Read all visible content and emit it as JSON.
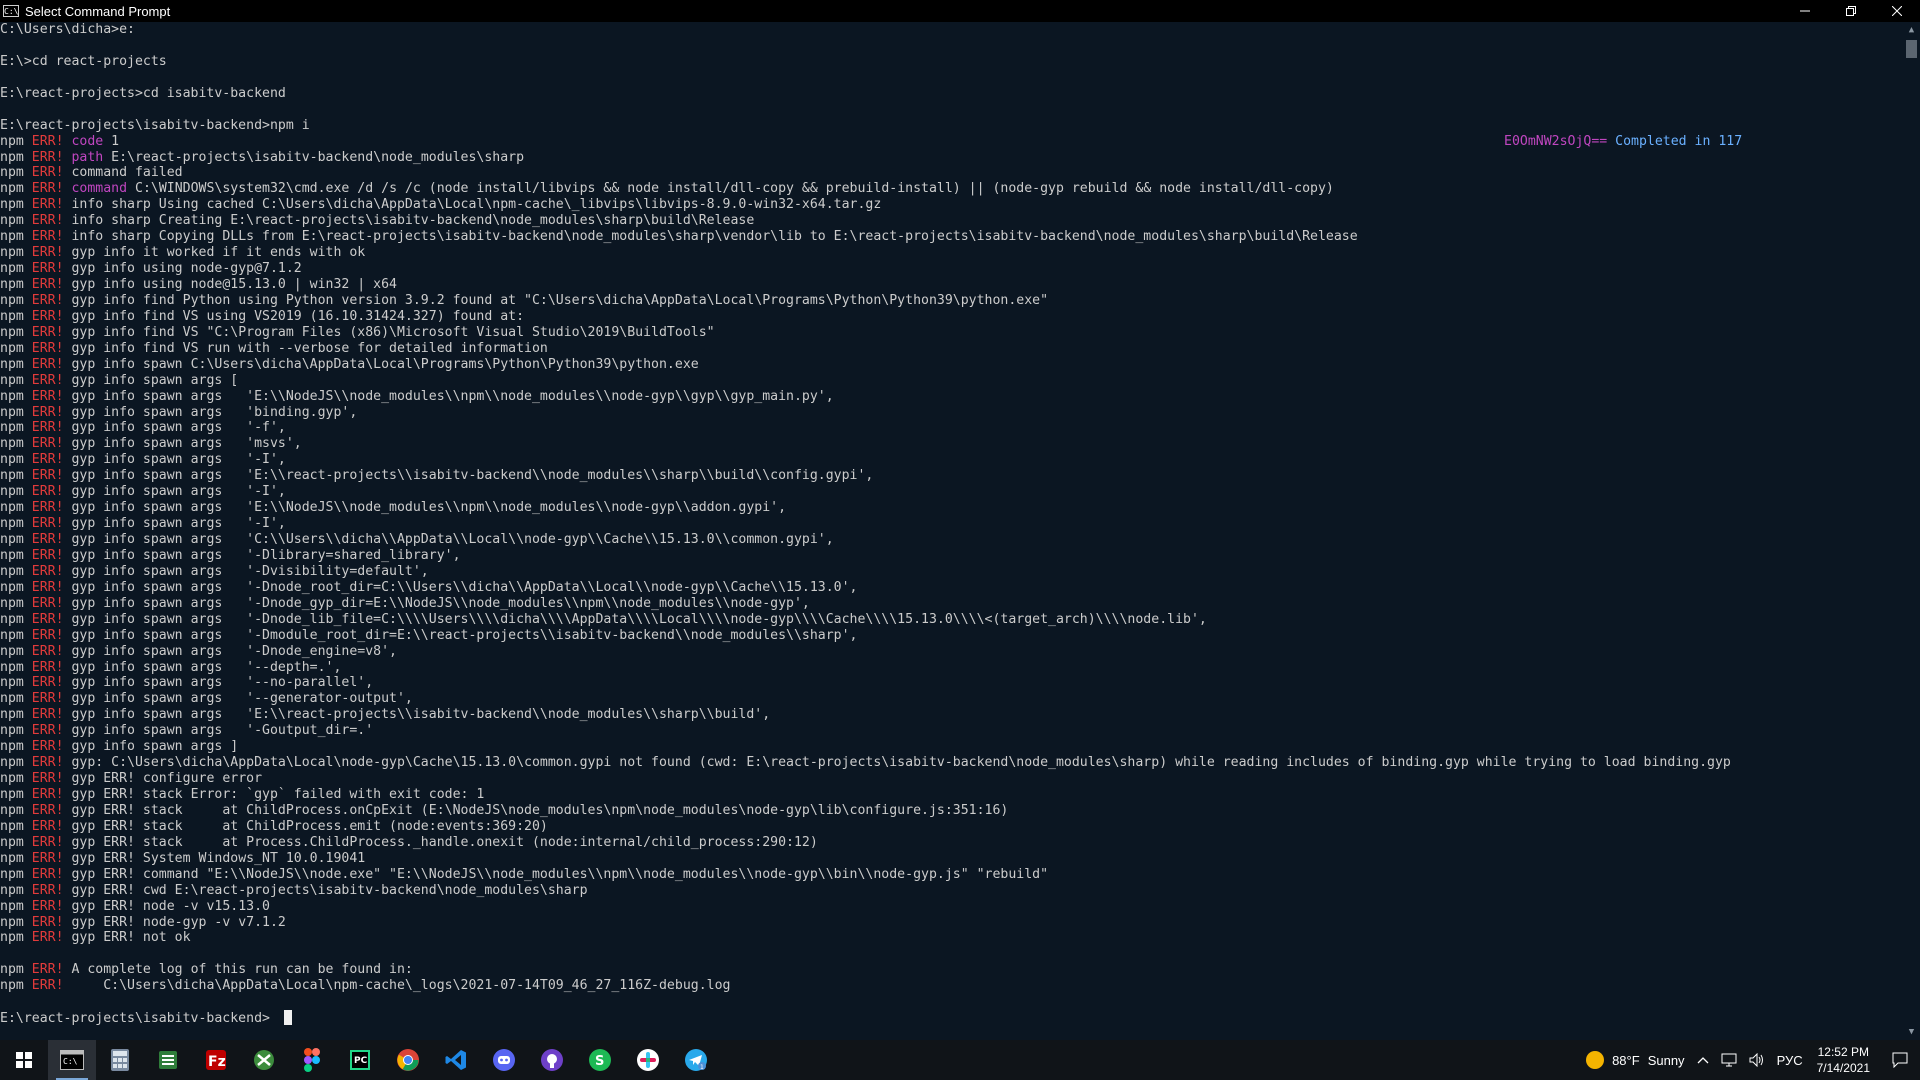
{
  "window": {
    "title": "Select Command Prompt",
    "icon_label": "C:\\"
  },
  "colors": {
    "background": "#0b1622",
    "text": "#cccccc",
    "err": "#e23b3b",
    "keyword": "#c046c0",
    "completed": "#6ab0ff"
  },
  "overlay": {
    "hash": "E0OmNW2sOjQ==",
    "completed": " Completed in 117"
  },
  "console_lines": [
    {
      "parts": [
        {
          "c": "txt",
          "t": "C:\\Users\\dicha>e:"
        }
      ]
    },
    {
      "parts": [
        {
          "c": "txt",
          "t": ""
        }
      ]
    },
    {
      "parts": [
        {
          "c": "txt",
          "t": "E:\\>cd react-projects"
        }
      ]
    },
    {
      "parts": [
        {
          "c": "txt",
          "t": ""
        }
      ]
    },
    {
      "parts": [
        {
          "c": "txt",
          "t": "E:\\react-projects>cd isabitv-backend"
        }
      ]
    },
    {
      "parts": [
        {
          "c": "txt",
          "t": ""
        }
      ]
    },
    {
      "parts": [
        {
          "c": "txt",
          "t": "E:\\react-projects\\isabitv-backend>npm i"
        }
      ]
    },
    {
      "parts": [
        {
          "c": "npm",
          "t": "npm "
        },
        {
          "c": "err",
          "t": "ERR!"
        },
        {
          "c": "kw",
          "t": " code"
        },
        {
          "c": "txt",
          "t": " 1"
        }
      ]
    },
    {
      "parts": [
        {
          "c": "npm",
          "t": "npm "
        },
        {
          "c": "err",
          "t": "ERR!"
        },
        {
          "c": "kw",
          "t": " path"
        },
        {
          "c": "txt",
          "t": " E:\\react-projects\\isabitv-backend\\node_modules\\sharp"
        }
      ]
    },
    {
      "parts": [
        {
          "c": "npm",
          "t": "npm "
        },
        {
          "c": "err",
          "t": "ERR!"
        },
        {
          "c": "txt",
          "t": " command failed"
        }
      ]
    },
    {
      "parts": [
        {
          "c": "npm",
          "t": "npm "
        },
        {
          "c": "err",
          "t": "ERR!"
        },
        {
          "c": "kw",
          "t": " command"
        },
        {
          "c": "txt",
          "t": " C:\\WINDOWS\\system32\\cmd.exe /d /s /c (node install/libvips && node install/dll-copy && prebuild-install) || (node-gyp rebuild && node install/dll-copy)"
        }
      ]
    },
    {
      "parts": [
        {
          "c": "npm",
          "t": "npm "
        },
        {
          "c": "err",
          "t": "ERR!"
        },
        {
          "c": "txt",
          "t": " info sharp Using cached C:\\Users\\dicha\\AppData\\Local\\npm-cache\\_libvips\\libvips-8.9.0-win32-x64.tar.gz"
        }
      ]
    },
    {
      "parts": [
        {
          "c": "npm",
          "t": "npm "
        },
        {
          "c": "err",
          "t": "ERR!"
        },
        {
          "c": "txt",
          "t": " info sharp Creating E:\\react-projects\\isabitv-backend\\node_modules\\sharp\\build\\Release"
        }
      ]
    },
    {
      "parts": [
        {
          "c": "npm",
          "t": "npm "
        },
        {
          "c": "err",
          "t": "ERR!"
        },
        {
          "c": "txt",
          "t": " info sharp Copying DLLs from E:\\react-projects\\isabitv-backend\\node_modules\\sharp\\vendor\\lib to E:\\react-projects\\isabitv-backend\\node_modules\\sharp\\build\\Release"
        }
      ]
    },
    {
      "parts": [
        {
          "c": "npm",
          "t": "npm "
        },
        {
          "c": "err",
          "t": "ERR!"
        },
        {
          "c": "txt",
          "t": " gyp info it worked if it ends with ok"
        }
      ]
    },
    {
      "parts": [
        {
          "c": "npm",
          "t": "npm "
        },
        {
          "c": "err",
          "t": "ERR!"
        },
        {
          "c": "txt",
          "t": " gyp info using node-gyp@7.1.2"
        }
      ]
    },
    {
      "parts": [
        {
          "c": "npm",
          "t": "npm "
        },
        {
          "c": "err",
          "t": "ERR!"
        },
        {
          "c": "txt",
          "t": " gyp info using node@15.13.0 | win32 | x64"
        }
      ]
    },
    {
      "parts": [
        {
          "c": "npm",
          "t": "npm "
        },
        {
          "c": "err",
          "t": "ERR!"
        },
        {
          "c": "txt",
          "t": " gyp info find Python using Python version 3.9.2 found at \"C:\\Users\\dicha\\AppData\\Local\\Programs\\Python\\Python39\\python.exe\""
        }
      ]
    },
    {
      "parts": [
        {
          "c": "npm",
          "t": "npm "
        },
        {
          "c": "err",
          "t": "ERR!"
        },
        {
          "c": "txt",
          "t": " gyp info find VS using VS2019 (16.10.31424.327) found at:"
        }
      ]
    },
    {
      "parts": [
        {
          "c": "npm",
          "t": "npm "
        },
        {
          "c": "err",
          "t": "ERR!"
        },
        {
          "c": "txt",
          "t": " gyp info find VS \"C:\\Program Files (x86)\\Microsoft Visual Studio\\2019\\BuildTools\""
        }
      ]
    },
    {
      "parts": [
        {
          "c": "npm",
          "t": "npm "
        },
        {
          "c": "err",
          "t": "ERR!"
        },
        {
          "c": "txt",
          "t": " gyp info find VS run with --verbose for detailed information"
        }
      ]
    },
    {
      "parts": [
        {
          "c": "npm",
          "t": "npm "
        },
        {
          "c": "err",
          "t": "ERR!"
        },
        {
          "c": "txt",
          "t": " gyp info spawn C:\\Users\\dicha\\AppData\\Local\\Programs\\Python\\Python39\\python.exe"
        }
      ]
    },
    {
      "parts": [
        {
          "c": "npm",
          "t": "npm "
        },
        {
          "c": "err",
          "t": "ERR!"
        },
        {
          "c": "txt",
          "t": " gyp info spawn args ["
        }
      ]
    },
    {
      "parts": [
        {
          "c": "npm",
          "t": "npm "
        },
        {
          "c": "err",
          "t": "ERR!"
        },
        {
          "c": "txt",
          "t": " gyp info spawn args   'E:\\\\NodeJS\\\\node_modules\\\\npm\\\\node_modules\\\\node-gyp\\\\gyp\\\\gyp_main.py',"
        }
      ]
    },
    {
      "parts": [
        {
          "c": "npm",
          "t": "npm "
        },
        {
          "c": "err",
          "t": "ERR!"
        },
        {
          "c": "txt",
          "t": " gyp info spawn args   'binding.gyp',"
        }
      ]
    },
    {
      "parts": [
        {
          "c": "npm",
          "t": "npm "
        },
        {
          "c": "err",
          "t": "ERR!"
        },
        {
          "c": "txt",
          "t": " gyp info spawn args   '-f',"
        }
      ]
    },
    {
      "parts": [
        {
          "c": "npm",
          "t": "npm "
        },
        {
          "c": "err",
          "t": "ERR!"
        },
        {
          "c": "txt",
          "t": " gyp info spawn args   'msvs',"
        }
      ]
    },
    {
      "parts": [
        {
          "c": "npm",
          "t": "npm "
        },
        {
          "c": "err",
          "t": "ERR!"
        },
        {
          "c": "txt",
          "t": " gyp info spawn args   '-I',"
        }
      ]
    },
    {
      "parts": [
        {
          "c": "npm",
          "t": "npm "
        },
        {
          "c": "err",
          "t": "ERR!"
        },
        {
          "c": "txt",
          "t": " gyp info spawn args   'E:\\\\react-projects\\\\isabitv-backend\\\\node_modules\\\\sharp\\\\build\\\\config.gypi',"
        }
      ]
    },
    {
      "parts": [
        {
          "c": "npm",
          "t": "npm "
        },
        {
          "c": "err",
          "t": "ERR!"
        },
        {
          "c": "txt",
          "t": " gyp info spawn args   '-I',"
        }
      ]
    },
    {
      "parts": [
        {
          "c": "npm",
          "t": "npm "
        },
        {
          "c": "err",
          "t": "ERR!"
        },
        {
          "c": "txt",
          "t": " gyp info spawn args   'E:\\\\NodeJS\\\\node_modules\\\\npm\\\\node_modules\\\\node-gyp\\\\addon.gypi',"
        }
      ]
    },
    {
      "parts": [
        {
          "c": "npm",
          "t": "npm "
        },
        {
          "c": "err",
          "t": "ERR!"
        },
        {
          "c": "txt",
          "t": " gyp info spawn args   '-I',"
        }
      ]
    },
    {
      "parts": [
        {
          "c": "npm",
          "t": "npm "
        },
        {
          "c": "err",
          "t": "ERR!"
        },
        {
          "c": "txt",
          "t": " gyp info spawn args   'C:\\\\Users\\\\dicha\\\\AppData\\\\Local\\\\node-gyp\\\\Cache\\\\15.13.0\\\\common.gypi',"
        }
      ]
    },
    {
      "parts": [
        {
          "c": "npm",
          "t": "npm "
        },
        {
          "c": "err",
          "t": "ERR!"
        },
        {
          "c": "txt",
          "t": " gyp info spawn args   '-Dlibrary=shared_library',"
        }
      ]
    },
    {
      "parts": [
        {
          "c": "npm",
          "t": "npm "
        },
        {
          "c": "err",
          "t": "ERR!"
        },
        {
          "c": "txt",
          "t": " gyp info spawn args   '-Dvisibility=default',"
        }
      ]
    },
    {
      "parts": [
        {
          "c": "npm",
          "t": "npm "
        },
        {
          "c": "err",
          "t": "ERR!"
        },
        {
          "c": "txt",
          "t": " gyp info spawn args   '-Dnode_root_dir=C:\\\\Users\\\\dicha\\\\AppData\\\\Local\\\\node-gyp\\\\Cache\\\\15.13.0',"
        }
      ]
    },
    {
      "parts": [
        {
          "c": "npm",
          "t": "npm "
        },
        {
          "c": "err",
          "t": "ERR!"
        },
        {
          "c": "txt",
          "t": " gyp info spawn args   '-Dnode_gyp_dir=E:\\\\NodeJS\\\\node_modules\\\\npm\\\\node_modules\\\\node-gyp',"
        }
      ]
    },
    {
      "parts": [
        {
          "c": "npm",
          "t": "npm "
        },
        {
          "c": "err",
          "t": "ERR!"
        },
        {
          "c": "txt",
          "t": " gyp info spawn args   '-Dnode_lib_file=C:\\\\\\\\Users\\\\\\\\dicha\\\\\\\\AppData\\\\\\\\Local\\\\\\\\node-gyp\\\\\\\\Cache\\\\\\\\15.13.0\\\\\\\\<(target_arch)\\\\\\\\node.lib',"
        }
      ]
    },
    {
      "parts": [
        {
          "c": "npm",
          "t": "npm "
        },
        {
          "c": "err",
          "t": "ERR!"
        },
        {
          "c": "txt",
          "t": " gyp info spawn args   '-Dmodule_root_dir=E:\\\\react-projects\\\\isabitv-backend\\\\node_modules\\\\sharp',"
        }
      ]
    },
    {
      "parts": [
        {
          "c": "npm",
          "t": "npm "
        },
        {
          "c": "err",
          "t": "ERR!"
        },
        {
          "c": "txt",
          "t": " gyp info spawn args   '-Dnode_engine=v8',"
        }
      ]
    },
    {
      "parts": [
        {
          "c": "npm",
          "t": "npm "
        },
        {
          "c": "err",
          "t": "ERR!"
        },
        {
          "c": "txt",
          "t": " gyp info spawn args   '--depth=.',"
        }
      ]
    },
    {
      "parts": [
        {
          "c": "npm",
          "t": "npm "
        },
        {
          "c": "err",
          "t": "ERR!"
        },
        {
          "c": "txt",
          "t": " gyp info spawn args   '--no-parallel',"
        }
      ]
    },
    {
      "parts": [
        {
          "c": "npm",
          "t": "npm "
        },
        {
          "c": "err",
          "t": "ERR!"
        },
        {
          "c": "txt",
          "t": " gyp info spawn args   '--generator-output',"
        }
      ]
    },
    {
      "parts": [
        {
          "c": "npm",
          "t": "npm "
        },
        {
          "c": "err",
          "t": "ERR!"
        },
        {
          "c": "txt",
          "t": " gyp info spawn args   'E:\\\\react-projects\\\\isabitv-backend\\\\node_modules\\\\sharp\\\\build',"
        }
      ]
    },
    {
      "parts": [
        {
          "c": "npm",
          "t": "npm "
        },
        {
          "c": "err",
          "t": "ERR!"
        },
        {
          "c": "txt",
          "t": " gyp info spawn args   '-Goutput_dir=.'"
        }
      ]
    },
    {
      "parts": [
        {
          "c": "npm",
          "t": "npm "
        },
        {
          "c": "err",
          "t": "ERR!"
        },
        {
          "c": "txt",
          "t": " gyp info spawn args ]"
        }
      ]
    },
    {
      "parts": [
        {
          "c": "npm",
          "t": "npm "
        },
        {
          "c": "err",
          "t": "ERR!"
        },
        {
          "c": "txt",
          "t": " gyp: C:\\Users\\dicha\\AppData\\Local\\node-gyp\\Cache\\15.13.0\\common.gypi not found (cwd: E:\\react-projects\\isabitv-backend\\node_modules\\sharp) while reading includes of binding.gyp while trying to load binding.gyp"
        }
      ]
    },
    {
      "parts": [
        {
          "c": "npm",
          "t": "npm "
        },
        {
          "c": "err",
          "t": "ERR!"
        },
        {
          "c": "txt",
          "t": " gyp ERR! configure error"
        }
      ]
    },
    {
      "parts": [
        {
          "c": "npm",
          "t": "npm "
        },
        {
          "c": "err",
          "t": "ERR!"
        },
        {
          "c": "txt",
          "t": " gyp ERR! stack Error: `gyp` failed with exit code: 1"
        }
      ]
    },
    {
      "parts": [
        {
          "c": "npm",
          "t": "npm "
        },
        {
          "c": "err",
          "t": "ERR!"
        },
        {
          "c": "txt",
          "t": " gyp ERR! stack     at ChildProcess.onCpExit (E:\\NodeJS\\node_modules\\npm\\node_modules\\node-gyp\\lib\\configure.js:351:16)"
        }
      ]
    },
    {
      "parts": [
        {
          "c": "npm",
          "t": "npm "
        },
        {
          "c": "err",
          "t": "ERR!"
        },
        {
          "c": "txt",
          "t": " gyp ERR! stack     at ChildProcess.emit (node:events:369:20)"
        }
      ]
    },
    {
      "parts": [
        {
          "c": "npm",
          "t": "npm "
        },
        {
          "c": "err",
          "t": "ERR!"
        },
        {
          "c": "txt",
          "t": " gyp ERR! stack     at Process.ChildProcess._handle.onexit (node:internal/child_process:290:12)"
        }
      ]
    },
    {
      "parts": [
        {
          "c": "npm",
          "t": "npm "
        },
        {
          "c": "err",
          "t": "ERR!"
        },
        {
          "c": "txt",
          "t": " gyp ERR! System Windows_NT 10.0.19041"
        }
      ]
    },
    {
      "parts": [
        {
          "c": "npm",
          "t": "npm "
        },
        {
          "c": "err",
          "t": "ERR!"
        },
        {
          "c": "txt",
          "t": " gyp ERR! command \"E:\\\\NodeJS\\\\node.exe\" \"E:\\\\NodeJS\\\\node_modules\\\\npm\\\\node_modules\\\\node-gyp\\\\bin\\\\node-gyp.js\" \"rebuild\""
        }
      ]
    },
    {
      "parts": [
        {
          "c": "npm",
          "t": "npm "
        },
        {
          "c": "err",
          "t": "ERR!"
        },
        {
          "c": "txt",
          "t": " gyp ERR! cwd E:\\react-projects\\isabitv-backend\\node_modules\\sharp"
        }
      ]
    },
    {
      "parts": [
        {
          "c": "npm",
          "t": "npm "
        },
        {
          "c": "err",
          "t": "ERR!"
        },
        {
          "c": "txt",
          "t": " gyp ERR! node -v v15.13.0"
        }
      ]
    },
    {
      "parts": [
        {
          "c": "npm",
          "t": "npm "
        },
        {
          "c": "err",
          "t": "ERR!"
        },
        {
          "c": "txt",
          "t": " gyp ERR! node-gyp -v v7.1.2"
        }
      ]
    },
    {
      "parts": [
        {
          "c": "npm",
          "t": "npm "
        },
        {
          "c": "err",
          "t": "ERR!"
        },
        {
          "c": "txt",
          "t": " gyp ERR! not ok"
        }
      ]
    },
    {
      "parts": [
        {
          "c": "txt",
          "t": ""
        }
      ]
    },
    {
      "parts": [
        {
          "c": "npm",
          "t": "npm "
        },
        {
          "c": "err",
          "t": "ERR!"
        },
        {
          "c": "txt",
          "t": " A complete log of this run can be found in:"
        }
      ]
    },
    {
      "parts": [
        {
          "c": "npm",
          "t": "npm "
        },
        {
          "c": "err",
          "t": "ERR!"
        },
        {
          "c": "txt",
          "t": "     C:\\Users\\dicha\\AppData\\Local\\npm-cache\\_logs\\2021-07-14T09_46_27_116Z-debug.log"
        }
      ]
    },
    {
      "parts": [
        {
          "c": "txt",
          "t": ""
        }
      ]
    }
  ],
  "prompt": "E:\\react-projects\\isabitv-backend>",
  "taskbar": {
    "apps": [
      {
        "name": "windows-start-icon",
        "glyph": "win"
      },
      {
        "name": "command-prompt-icon",
        "glyph": "cmd",
        "active": true
      },
      {
        "name": "calculator-icon",
        "glyph": "calc"
      },
      {
        "name": "spreadsheet-app-icon",
        "glyph": "sheet"
      },
      {
        "name": "filezilla-icon",
        "glyph": "fz"
      },
      {
        "name": "xbox-icon",
        "glyph": "xbox"
      },
      {
        "name": "figma-icon",
        "glyph": "figma"
      },
      {
        "name": "pycharm-icon",
        "glyph": "pc"
      },
      {
        "name": "chrome-icon",
        "glyph": "chrome"
      },
      {
        "name": "vscode-icon",
        "glyph": "vscode"
      },
      {
        "name": "discord-icon",
        "glyph": "discord"
      },
      {
        "name": "github-desktop-icon",
        "glyph": "github"
      },
      {
        "name": "skype-icon",
        "glyph": "skype"
      },
      {
        "name": "slack-icon",
        "glyph": "slack"
      },
      {
        "name": "telegram-icon",
        "glyph": "telegram"
      }
    ],
    "weather": {
      "temp": "88°F",
      "condition": "Sunny"
    },
    "language": "РУС",
    "time": "12:52 PM",
    "date": "7/14/2021"
  }
}
